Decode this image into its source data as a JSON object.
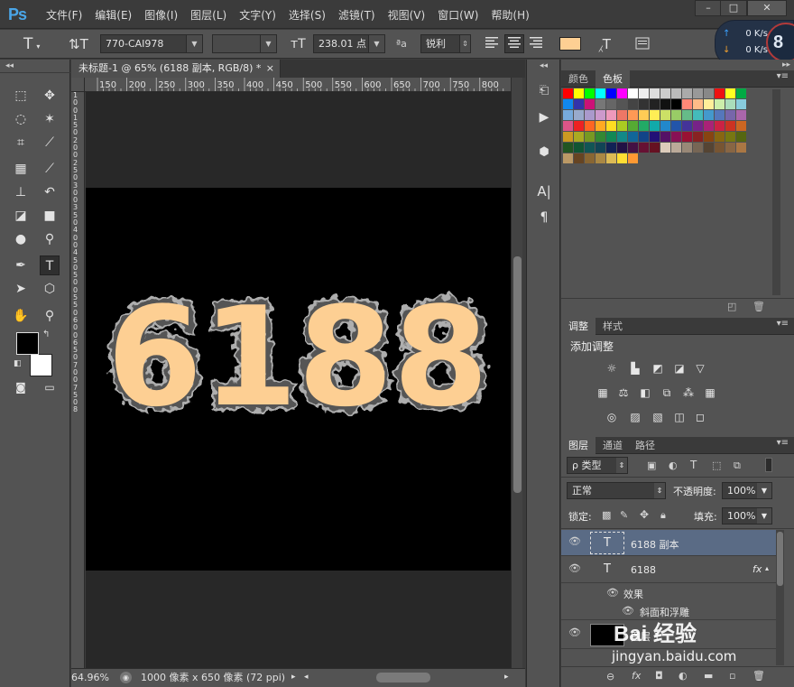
{
  "app": {
    "logo": "Ps",
    "menus": [
      "文件(F)",
      "编辑(E)",
      "图像(I)",
      "图层(L)",
      "文字(Y)",
      "选择(S)",
      "滤镜(T)",
      "视图(V)",
      "窗口(W)",
      "帮助(H)"
    ],
    "window_buttons": [
      "–",
      "□",
      "✕"
    ]
  },
  "options": {
    "font_family": "770-CAI978",
    "font_style": "",
    "font_size": "238.01 点",
    "antialias_prefix": "ªa",
    "antialias": "锐利",
    "text_color": "#fdcf93"
  },
  "network": {
    "up": "0 K/s",
    "down": "0 K/s",
    "badge": "8"
  },
  "document": {
    "tab_title": "未标题-1 @ 65% (6188 副本, RGB/8) *",
    "close": "×",
    "zoom": "64.96%",
    "doc_info": "1000 像素 x 650 像素 (72 ppi)",
    "artwork_text": "6188",
    "ruler_h": [
      "150",
      "200",
      "250",
      "300",
      "350",
      "400",
      "450",
      "500",
      "550",
      "600",
      "650",
      "700",
      "750",
      "800"
    ],
    "ruler_v": [
      "1",
      "0",
      "0",
      "1",
      "5",
      "0",
      "2",
      "0",
      "0",
      "2",
      "5",
      "0",
      "3",
      "0",
      "0",
      "3",
      "5",
      "0",
      "4",
      "0",
      "0",
      "4",
      "5",
      "0",
      "5",
      "0",
      "0",
      "5",
      "5",
      "0",
      "6",
      "0",
      "0",
      "6",
      "5",
      "0",
      "7",
      "0",
      "0",
      "7",
      "5",
      "0",
      "8"
    ]
  },
  "panels": {
    "swatches": {
      "tabs": [
        "颜色",
        "色板"
      ]
    },
    "adjustments": {
      "tabs": [
        "调整",
        "样式"
      ],
      "title": "添加调整"
    },
    "layers": {
      "tabs": [
        "图层",
        "通道",
        "路径"
      ],
      "filter": "ρ 类型",
      "blend": "正常",
      "opacity_label": "不透明度:",
      "opacity": "100%",
      "lock_label": "锁定:",
      "fill_label": "填充:",
      "fill": "100%",
      "items": [
        {
          "name": "6188 副本",
          "type": "T"
        },
        {
          "name": "6188",
          "type": "T",
          "fx": "fx"
        },
        {
          "name": "效果"
        },
        {
          "name": "斜面和浮雕"
        },
        {
          "name": "图层 1"
        }
      ]
    },
    "bottom_icons": [
      "⊖",
      "fx",
      "◘",
      "◐",
      "▬",
      "▫",
      "🗑"
    ]
  },
  "watermark": {
    "brand": "Bai 经验",
    "url": "jingyan.baidu.com"
  },
  "colors": {
    "fg": "#000000",
    "bg": "#ffffff",
    "canvas": "#000000",
    "text_fill": "#fdcf93"
  }
}
